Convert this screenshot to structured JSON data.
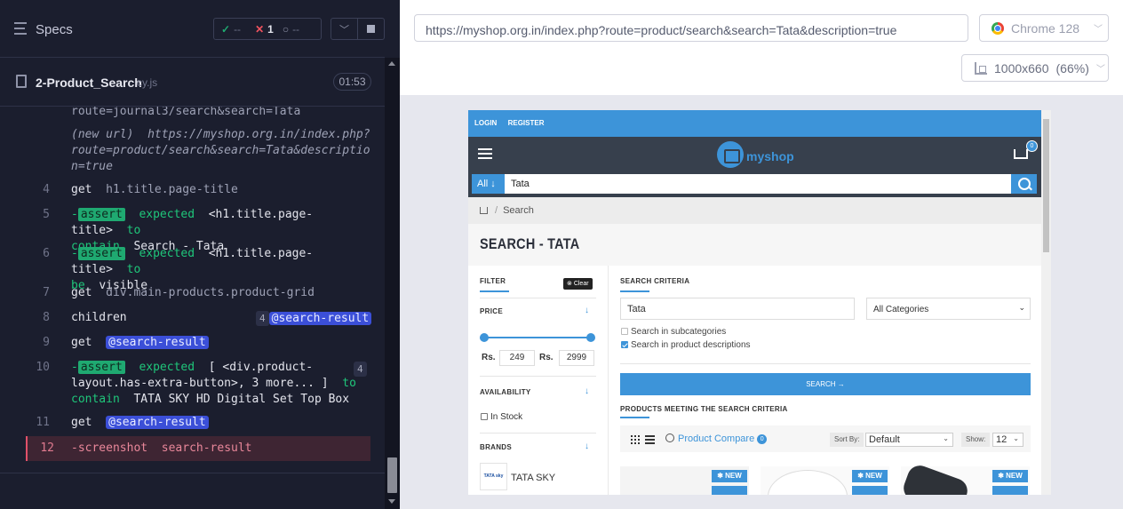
{
  "reporter": {
    "specs_title": "Specs",
    "stats": {
      "passed": "--",
      "failed": "1",
      "pending": "--"
    },
    "file": {
      "name": "2-Product_Search",
      "ext": "cy.js",
      "duration": "01:53"
    },
    "commands": [
      {
        "num": "",
        "text": "route=journal3/search&search=Tata"
      },
      {
        "num": "",
        "note_prefix": "(new url)",
        "url": "https://myshop.org.in/index.php?route=product/search&search=Tata&description=true"
      },
      {
        "num": "4",
        "cmd": "get",
        "arg": "h1.title.page-title"
      },
      {
        "num": "5",
        "assert": "assert",
        "pre": "expected",
        "subject": "<h1.title.page-title>",
        "mid": "to",
        "line2a": "contain",
        "line2b": "Search - Tata"
      },
      {
        "num": "6",
        "assert": "assert",
        "pre": "expected",
        "subject": "<h1.title.page-title>",
        "mid": "to",
        "line2a": "be",
        "line2b": "visible"
      },
      {
        "num": "7",
        "cmd": "get",
        "arg": "div.main-products.product-grid"
      },
      {
        "num": "8",
        "cmd": "children",
        "count": "4",
        "alias": "@search-result"
      },
      {
        "num": "9",
        "cmd": "get",
        "alias": "@search-result"
      },
      {
        "num": "10",
        "assert": "assert",
        "pre": "expected",
        "subject": "[ <div.product-",
        "line2a": "layout.has-extra-button>, 3 more... ]",
        "line2b": "to",
        "line3a": "contain",
        "line3b": "TATA SKY HD Digital Set Top Box",
        "count": "4"
      },
      {
        "num": "11",
        "cmd": "get",
        "alias": "@search-result"
      },
      {
        "num": "12",
        "cmd": "screenshot",
        "arg": "search-result"
      }
    ]
  },
  "browser": {
    "url": "https://myshop.org.in/index.php?route=product/search&search=Tata&description=true",
    "name": "Chrome 128",
    "viewport": "1000x660",
    "scale": "(66%)"
  },
  "aut": {
    "top_links": [
      "LOGIN",
      "REGISTER"
    ],
    "logo_text": "myshop",
    "cart_count": "0",
    "search_category": "All",
    "search_query": "Tata",
    "breadcrumb": "Search",
    "title": "SEARCH - TATA",
    "filter": {
      "title": "FILTER",
      "clear": "Clear",
      "price_title": "PRICE",
      "price_currency": "Rs.",
      "price_min": "249",
      "price_max": "2999",
      "availability_title": "AVAILABILITY",
      "in_stock": "In Stock",
      "brands_title": "BRANDS",
      "brand": "TATA SKY",
      "brand_logo_text": "TATA sky"
    },
    "criteria": {
      "title": "SEARCH CRITERIA",
      "keyword": "Tata",
      "category": "All Categories",
      "subcategories": "Search in subcategories",
      "descriptions": "Search in product descriptions",
      "button": "SEARCH →"
    },
    "results_title": "PRODUCTS MEETING THE SEARCH CRITERIA",
    "toolbar": {
      "compare": "Product Compare",
      "compare_count": "0",
      "sort_label": "Sort By:",
      "sort_value": "Default",
      "show_label": "Show:",
      "show_value": "12"
    },
    "badge_new": "NEW"
  }
}
